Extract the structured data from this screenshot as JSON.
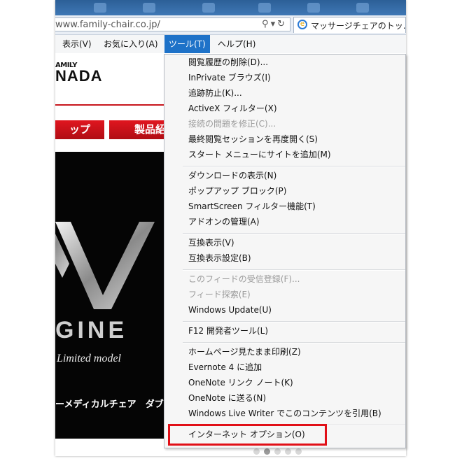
{
  "browser": {
    "address": "www.family-chair.co.jp/",
    "tab_title": "マッサージチェアのトッ..."
  },
  "menubar": {
    "items": [
      "表示(V)",
      "お気に入り(A)",
      "ツール(T)",
      "ヘルプ(H)"
    ]
  },
  "page": {
    "logo_small": "AMILY",
    "logo_big": "NADA",
    "nav_left": "ップ",
    "nav_right": "製品紹",
    "hero_engine": "GINE",
    "hero_limited": "Limited model",
    "hero_caption": "ーメディカルチェア　ダブ"
  },
  "dropdown": {
    "items": [
      {
        "label": "閲覧履歴の削除(D)...",
        "disabled": false
      },
      {
        "label": "InPrivate ブラウズ(I)",
        "disabled": false
      },
      {
        "label": "追跡防止(K)...",
        "disabled": false
      },
      {
        "label": "ActiveX フィルター(X)",
        "disabled": false
      },
      {
        "label": "接続の問題を修正(C)...",
        "disabled": true
      },
      {
        "label": "最終閲覧セッションを再度開く(S)",
        "disabled": false
      },
      {
        "label": "スタート メニューにサイトを追加(M)",
        "disabled": false
      },
      {
        "label": "ダウンロードの表示(N)",
        "disabled": false
      },
      {
        "label": "ポップアップ ブロック(P)",
        "disabled": false
      },
      {
        "label": "SmartScreen フィルター機能(T)",
        "disabled": false
      },
      {
        "label": "アドオンの管理(A)",
        "disabled": false
      },
      {
        "label": "互換表示(V)",
        "disabled": false
      },
      {
        "label": "互換表示設定(B)",
        "disabled": false
      },
      {
        "label": "このフィードの受信登録(F)...",
        "disabled": true
      },
      {
        "label": "フィード探索(E)",
        "disabled": true
      },
      {
        "label": "Windows Update(U)",
        "disabled": false
      },
      {
        "label": "F12 開発者ツール(L)",
        "disabled": false
      },
      {
        "label": "ホームページ見たまま印刷(Z)",
        "disabled": false
      },
      {
        "label": "Evernote 4 に追加",
        "disabled": false
      },
      {
        "label": "OneNote リンク ノート(K)",
        "disabled": false
      },
      {
        "label": "OneNote に送る(N)",
        "disabled": false
      },
      {
        "label": "Windows Live Writer でこのコンテンツを引用(B)",
        "disabled": false
      },
      {
        "label": "インターネット オプション(O)",
        "disabled": false
      }
    ]
  },
  "colors": {
    "menu_active": "#1e72c8",
    "highlight": "#e10f17",
    "brand_red": "#c8161d"
  }
}
